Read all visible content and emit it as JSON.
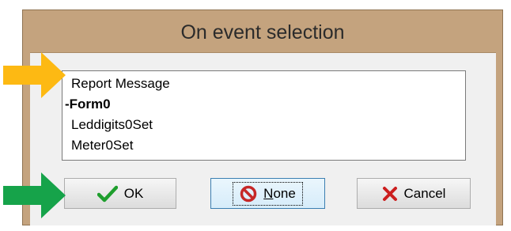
{
  "dialog": {
    "title": "On event selection"
  },
  "event_list": {
    "items": [
      {
        "label": "Report Message",
        "header": false
      },
      {
        "label": "-Form0",
        "header": true
      },
      {
        "label": "Leddigits0Set",
        "header": false
      },
      {
        "label": "Meter0Set",
        "header": false
      }
    ]
  },
  "buttons": {
    "ok": {
      "label": "OK",
      "icon": "check-icon"
    },
    "none": {
      "label_prefix": "",
      "mnemonic": "N",
      "label_rest": "one",
      "icon": "no-entry-icon"
    },
    "cancel": {
      "label": "Cancel",
      "icon": "x-icon"
    }
  },
  "annotations": {
    "arrow_list_color": "#fdb913",
    "arrow_ok_color": "#16a34a"
  }
}
